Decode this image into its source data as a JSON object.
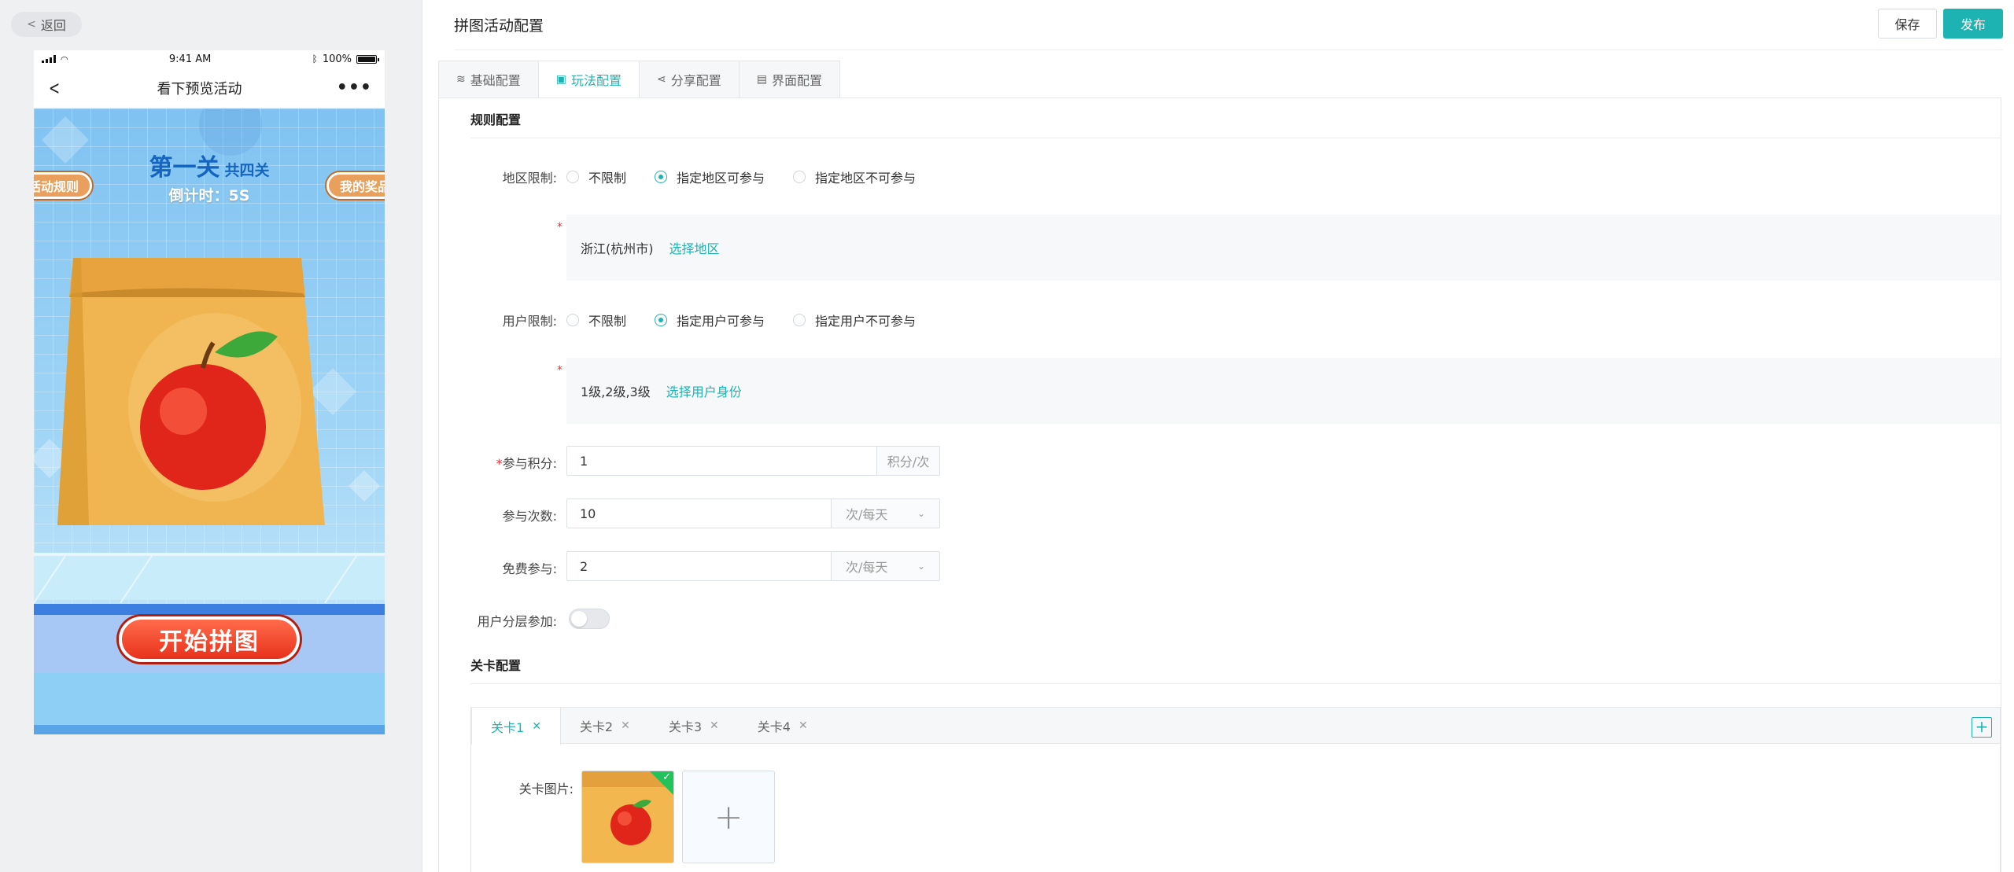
{
  "left": {
    "back_label": "返回",
    "phone": {
      "time": "9:41 AM",
      "battery": "100%",
      "nav_title": "看下预览活动",
      "more": "•••"
    },
    "game": {
      "level_title": "第一关",
      "level_total": "共四关",
      "countdown": "倒计时：5S",
      "tag_left": "活动规则",
      "tag_right": "我的奖品",
      "start_button": "开始拼图"
    }
  },
  "header": {
    "title": "拼图活动配置",
    "save_label": "保存",
    "publish_label": "发布"
  },
  "tabs": [
    {
      "label": "基础配置",
      "icon": "layers-icon",
      "active": false
    },
    {
      "label": "玩法配置",
      "icon": "gift-icon",
      "active": true
    },
    {
      "label": "分享配置",
      "icon": "share-icon",
      "active": false
    },
    {
      "label": "界面配置",
      "icon": "page-icon",
      "active": false
    }
  ],
  "rules": {
    "section_title": "规则配置",
    "region": {
      "label": "地区限制:",
      "options": [
        "不限制",
        "指定地区可参与",
        "指定地区不可参与"
      ],
      "selected": 1,
      "value": "浙江(杭州市)",
      "action": "选择地区"
    },
    "user": {
      "label": "用户限制:",
      "options": [
        "不限制",
        "指定用户可参与",
        "指定用户不可参与"
      ],
      "selected": 1,
      "value": "1级,2级,3级",
      "action": "选择用户身份"
    },
    "points": {
      "label": "参与积分:",
      "value": "1",
      "unit": "积分/次"
    },
    "times": {
      "label": "参与次数:",
      "value": "10",
      "unit": "次/每天"
    },
    "free": {
      "label": "免费参与:",
      "value": "2",
      "unit": "次/每天"
    },
    "tier": {
      "label": "用户分层参加:",
      "enabled": false
    }
  },
  "levels": {
    "section_title": "关卡配置",
    "tabs": [
      "关卡1",
      "关卡2",
      "关卡3",
      "关卡4"
    ],
    "active": 0,
    "image_label": "关卡图片:"
  },
  "colors": {
    "accent": "#1eb3b3",
    "required": "#ee3333"
  }
}
